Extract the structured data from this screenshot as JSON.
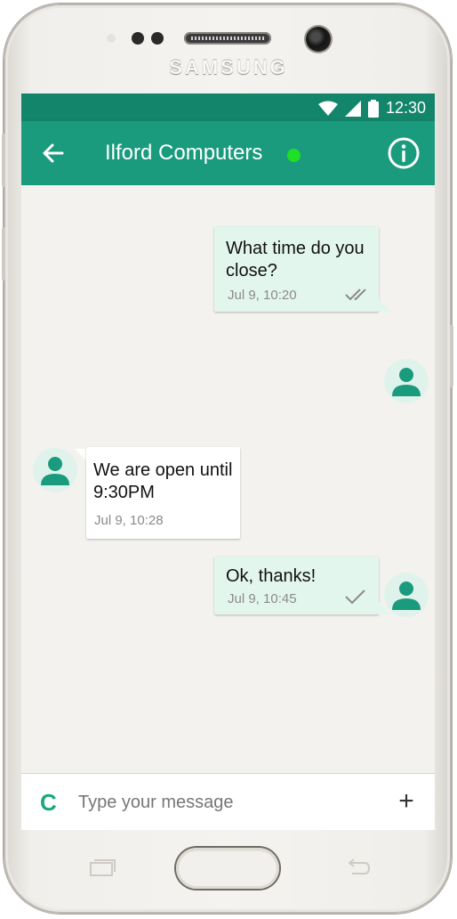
{
  "device": {
    "brand": "SAMSUNG"
  },
  "status_bar": {
    "time": "12:30",
    "icons": [
      "wifi-icon",
      "signal-icon",
      "battery-icon"
    ]
  },
  "header": {
    "title": "Ilford Computers",
    "online_color": "#1ee024",
    "back_icon": "arrow-left-icon",
    "info_icon": "info-icon"
  },
  "messages": [
    {
      "direction": "outgoing",
      "lines": [
        "What time do you",
        "close?"
      ],
      "time": "Jul 9, 10:20",
      "receipt": "double-check"
    },
    {
      "direction": "incoming",
      "lines": [
        "We are open until",
        "9:30PM"
      ],
      "time": "Jul 9, 10:28"
    },
    {
      "direction": "outgoing",
      "lines": [
        "Ok, thanks!"
      ],
      "time": "Jul 9, 10:45",
      "receipt": "single-check"
    }
  ],
  "composer": {
    "logo": "C",
    "placeholder": "Type your message",
    "value": "",
    "add_label": "+"
  },
  "colors": {
    "primary": "#1a9b7d",
    "primary_dark": "#13856a",
    "outgoing_bubble": "#e3f6ee",
    "accent": "#1aa880"
  }
}
